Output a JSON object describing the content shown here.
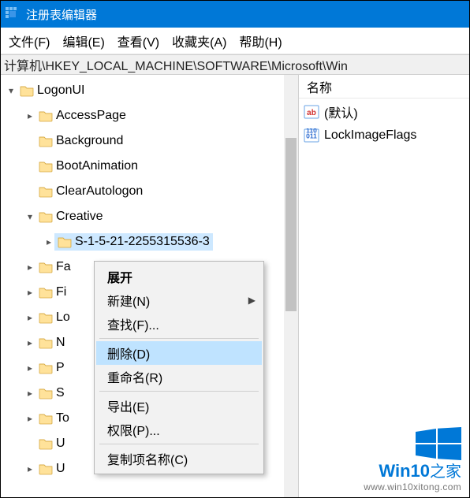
{
  "window": {
    "title": "注册表编辑器"
  },
  "menubar": {
    "file": "文件(F)",
    "edit": "编辑(E)",
    "view": "查看(V)",
    "favorites": "收藏夹(A)",
    "help": "帮助(H)"
  },
  "addressbar": {
    "path": "计算机\\HKEY_LOCAL_MACHINE\\SOFTWARE\\Microsoft\\Win"
  },
  "tree": {
    "items": [
      {
        "indent": 0,
        "expander": "▾",
        "label": "LogonUI"
      },
      {
        "indent": 1,
        "expander": "▸",
        "label": "AccessPage"
      },
      {
        "indent": 1,
        "expander": "",
        "label": "Background"
      },
      {
        "indent": 1,
        "expander": "",
        "label": "BootAnimation"
      },
      {
        "indent": 1,
        "expander": "",
        "label": "ClearAutologon"
      },
      {
        "indent": 1,
        "expander": "▾",
        "label": "Creative"
      },
      {
        "indent": 2,
        "expander": "▸",
        "label": "S-1-5-21-2255315536-3",
        "selected": true
      },
      {
        "indent": 1,
        "expander": "▸",
        "label": "Fa"
      },
      {
        "indent": 1,
        "expander": "▸",
        "label": "Fi"
      },
      {
        "indent": 1,
        "expander": "▸",
        "label": "Lo"
      },
      {
        "indent": 1,
        "expander": "▸",
        "label": "N"
      },
      {
        "indent": 1,
        "expander": "▸",
        "label": "P"
      },
      {
        "indent": 1,
        "expander": "▸",
        "label": "S"
      },
      {
        "indent": 1,
        "expander": "▸",
        "label": "To"
      },
      {
        "indent": 1,
        "expander": "",
        "label": "U"
      },
      {
        "indent": 1,
        "expander": "▸",
        "label": "U"
      }
    ]
  },
  "list": {
    "header_name": "名称",
    "rows": [
      {
        "type": "string",
        "label": "(默认)"
      },
      {
        "type": "dword",
        "label": "LockImageFlags"
      }
    ]
  },
  "context_menu": {
    "expand": "展开",
    "new": "新建(N)",
    "find": "查找(F)...",
    "delete": "删除(D)",
    "rename": "重命名(R)",
    "export": "导出(E)",
    "perms": "权限(P)...",
    "copyname": "复制项名称(C)"
  },
  "watermark": {
    "brand_en": "Win10",
    "brand_zh": "之家",
    "url": "www.win10xitong.com"
  },
  "colors": {
    "accent": "#0078d7",
    "selection": "#cde8ff",
    "menu_hover": "#bfe3ff"
  }
}
